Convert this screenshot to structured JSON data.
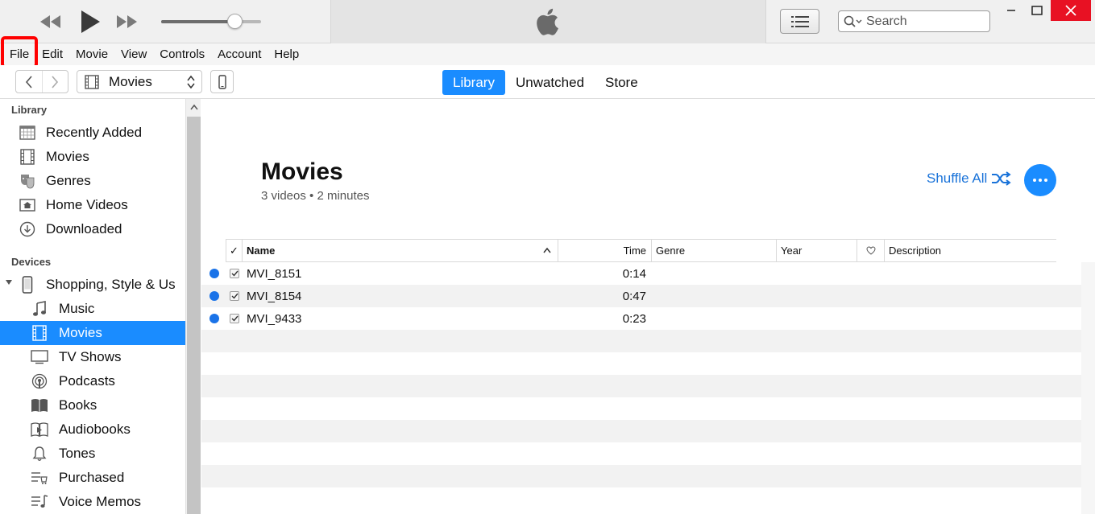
{
  "player": {
    "volume_level": 0.74,
    "search_placeholder": "Search"
  },
  "menu": [
    "File",
    "Edit",
    "Movie",
    "View",
    "Controls",
    "Account",
    "Help"
  ],
  "nav": {
    "media_type": "Movies",
    "tabs": [
      {
        "label": "Library",
        "active": true
      },
      {
        "label": "Unwatched",
        "active": false
      },
      {
        "label": "Store",
        "active": false
      }
    ]
  },
  "sidebar": {
    "library_heading": "Library",
    "library_items": [
      {
        "label": "Recently Added",
        "icon": "calendar-grid-icon"
      },
      {
        "label": "Movies",
        "icon": "film-strip-icon"
      },
      {
        "label": "Genres",
        "icon": "theater-masks-icon"
      },
      {
        "label": "Home Videos",
        "icon": "home-video-icon"
      },
      {
        "label": "Downloaded",
        "icon": "download-circle-icon"
      }
    ],
    "devices_heading": "Devices",
    "device": {
      "label": "Shopping, Style & Us",
      "icon": "phone-icon"
    },
    "device_items": [
      {
        "label": "Music",
        "icon": "music-note-icon",
        "selected": false
      },
      {
        "label": "Movies",
        "icon": "film-strip-icon",
        "selected": true
      },
      {
        "label": "TV Shows",
        "icon": "tv-icon",
        "selected": false
      },
      {
        "label": "Podcasts",
        "icon": "podcast-icon",
        "selected": false
      },
      {
        "label": "Books",
        "icon": "book-icon",
        "selected": false
      },
      {
        "label": "Audiobooks",
        "icon": "audiobook-icon",
        "selected": false
      },
      {
        "label": "Tones",
        "icon": "bell-icon",
        "selected": false
      },
      {
        "label": "Purchased",
        "icon": "purchased-list-icon",
        "selected": false
      },
      {
        "label": "Voice Memos",
        "icon": "voice-memo-icon",
        "selected": false
      }
    ]
  },
  "main": {
    "title": "Movies",
    "subtitle": "3 videos • 2 minutes",
    "shuffle_label": "Shuffle All",
    "table": {
      "columns": {
        "check": "✓",
        "name": "Name",
        "time": "Time",
        "genre": "Genre",
        "year": "Year",
        "description": "Description"
      },
      "rows": [
        {
          "name": "MVI_8151",
          "time": "0:14"
        },
        {
          "name": "MVI_8154",
          "time": "0:47"
        },
        {
          "name": "MVI_9433",
          "time": "0:23"
        }
      ]
    }
  },
  "colors": {
    "accent": "#1a8cff",
    "link": "#1a73d9",
    "close": "#e81123",
    "annotation": "#ff0000"
  }
}
